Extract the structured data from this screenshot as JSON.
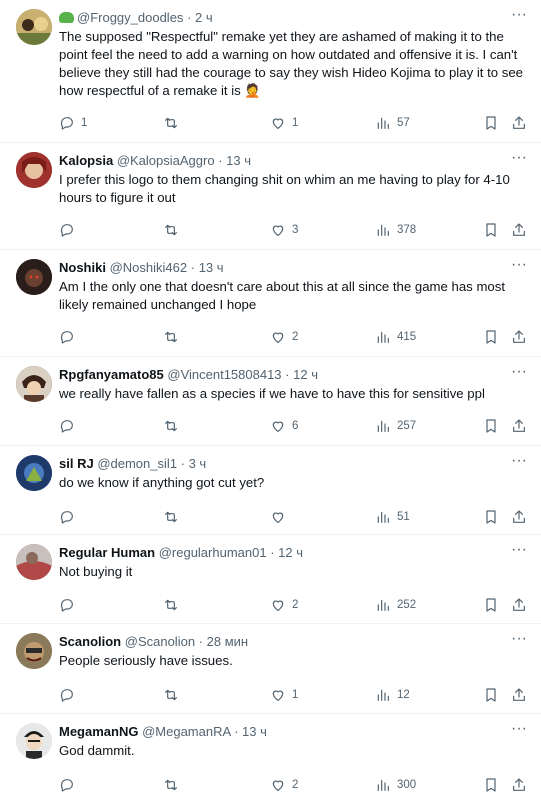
{
  "tweets": [
    {
      "display_name": "",
      "name_emoji": "frog-emoji",
      "handle": "@Froggy_doodles",
      "time": "2 ч",
      "text": "The supposed \"Respectful\" remake yet they are ashamed of making it to the point feel the need to add a warning on how outdated and offensive it is. I can't believe they still had the courage to say they wish Hideo Kojima to play it to see how respectful of a remake it is 🤦",
      "replies": "1",
      "retweets": "",
      "likes": "1",
      "views": "57",
      "avatar_color": "#6b7a3a"
    },
    {
      "display_name": "Kalopsia",
      "handle": "@KalopsiaAggro",
      "time": "13 ч",
      "text": "I prefer this logo to them changing shit on whim an me having to play for 4-10 hours to figure it out",
      "replies": "",
      "retweets": "",
      "likes": "3",
      "views": "378",
      "avatar_color": "#a0322e"
    },
    {
      "display_name": "Noshiki",
      "handle": "@Noshiki462",
      "time": "13 ч",
      "text": "Am I the only one that doesn't care about this at all since the game has most likely remained unchanged I hope",
      "replies": "",
      "retweets": "",
      "likes": "2",
      "views": "415",
      "avatar_color": "#3a2a22"
    },
    {
      "display_name": "Rpgfanyamato85",
      "handle": "@Vincent15808413",
      "time": "12 ч",
      "text": "we really have fallen as a species if we have to have this for sensitive ppl",
      "replies": "",
      "retweets": "",
      "likes": "6",
      "views": "257",
      "avatar_color": "#5a3a2a"
    },
    {
      "display_name": "sil RJ",
      "handle": "@demon_sil1",
      "time": "3 ч",
      "text": "do we know if anything got cut yet?",
      "replies": "",
      "retweets": "",
      "likes": "",
      "views": "51",
      "avatar_color": "#2e4f8a"
    },
    {
      "display_name": "Regular Human",
      "handle": "@regularhuman01",
      "time": "12 ч",
      "text": "Not buying it",
      "replies": "",
      "retweets": "",
      "likes": "2",
      "views": "252",
      "avatar_color": "#b04848"
    },
    {
      "display_name": "Scanolion",
      "handle": "@Scanolion",
      "time": "28 мин",
      "text": "People seriously have issues.",
      "replies": "",
      "retweets": "",
      "likes": "1",
      "views": "12",
      "avatar_color": "#6a5a3e"
    },
    {
      "display_name": "MegamanNG",
      "handle": "@MegamanRA",
      "time": "13 ч",
      "text": "God dammit.",
      "replies": "",
      "retweets": "",
      "likes": "2",
      "views": "300",
      "avatar_color": "#d8d8d8"
    }
  ],
  "icons": {
    "reply": "reply-icon",
    "retweet": "retweet-icon",
    "like": "like-icon",
    "views": "views-icon",
    "bookmark": "bookmark-icon",
    "share": "share-icon",
    "more": "more-icon"
  },
  "separator": "·",
  "more_glyph": "···"
}
